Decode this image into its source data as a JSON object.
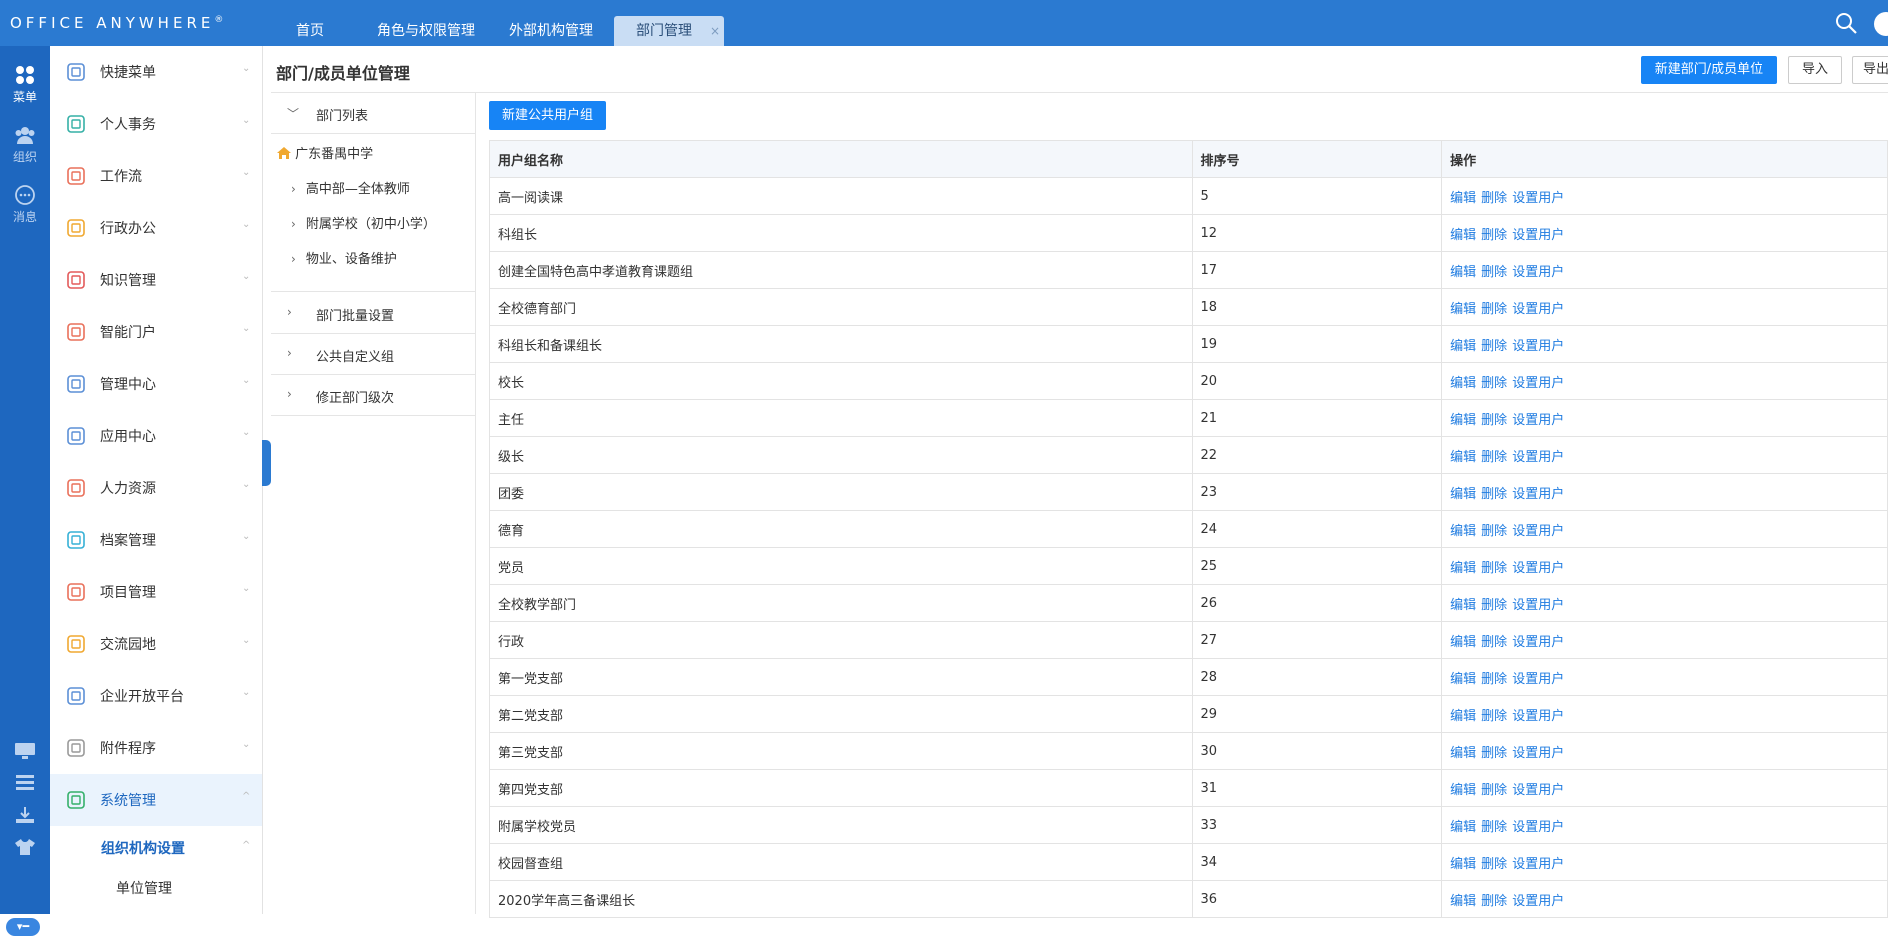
{
  "app": {
    "logo": "OFFICE ANYWHERE",
    "logo_mark": "®",
    "tabs": [
      {
        "label": "首页"
      },
      {
        "label": "角色与权限管理"
      },
      {
        "label": "外部机构管理"
      },
      {
        "label": "部门管理",
        "active": true,
        "close": "×"
      }
    ]
  },
  "rail": {
    "items": [
      {
        "label": "菜单",
        "icon": "apps-icon"
      },
      {
        "label": "组织",
        "icon": "users-icon"
      },
      {
        "label": "消息",
        "icon": "chat-icon"
      }
    ],
    "bottom_icons": [
      "monitor-icon",
      "list-icon",
      "download-icon",
      "shirt-icon"
    ],
    "toggle_label": "▾━"
  },
  "menu": {
    "items": [
      {
        "label": "快捷菜单",
        "icon": "grid-icon",
        "color": "#5b8fd6"
      },
      {
        "label": "个人事务",
        "icon": "person-icon",
        "color": "#35b0a6"
      },
      {
        "label": "工作流",
        "icon": "flow-icon",
        "color": "#e9705a"
      },
      {
        "label": "行政办公",
        "icon": "briefcase-icon",
        "color": "#f0a830"
      },
      {
        "label": "知识管理",
        "icon": "book-icon",
        "color": "#e35a5a"
      },
      {
        "label": "智能门户",
        "icon": "portal-icon",
        "color": "#e9705a"
      },
      {
        "label": "管理中心",
        "icon": "monitor-chart-icon",
        "color": "#5b8fd6"
      },
      {
        "label": "应用中心",
        "icon": "bag-icon",
        "color": "#5b8fd6"
      },
      {
        "label": "人力资源",
        "icon": "people-icon",
        "color": "#e9705a"
      },
      {
        "label": "档案管理",
        "icon": "archive-icon",
        "color": "#35b0d6"
      },
      {
        "label": "项目管理",
        "icon": "stack-icon",
        "color": "#e9705a"
      },
      {
        "label": "交流园地",
        "icon": "cup-icon",
        "color": "#f0a830"
      },
      {
        "label": "企业开放平台",
        "icon": "cube-icon",
        "color": "#5b8fd6"
      },
      {
        "label": "附件程序",
        "icon": "paperclip-icon",
        "color": "#999999"
      },
      {
        "label": "系统管理",
        "icon": "settings-icon",
        "color": "#35b06a",
        "active": true
      }
    ],
    "submenu": {
      "label": "组织机构设置"
    },
    "subsubmenu": {
      "label": "单位管理"
    }
  },
  "page": {
    "title": "部门/成员单位管理",
    "new_dept_label": "新建部门/成员单位",
    "import_label": "导入",
    "export_label": "导出"
  },
  "tree": {
    "list_label": "部门列表",
    "root": "广东番禺中学",
    "children": [
      "高中部—全体教师",
      "附属学校（初中小学）",
      "物业、设备维护"
    ],
    "sections": [
      "部门批量设置",
      "公共自定义组",
      "修正部门级次"
    ]
  },
  "table": {
    "new_group_label": "新建公共用户组",
    "headers": [
      "用户组名称",
      "排序号",
      "操作"
    ],
    "ops": [
      "编辑",
      "删除",
      "设置用户"
    ],
    "rows": [
      {
        "name": "高一阅读课",
        "order": "5"
      },
      {
        "name": "科组长",
        "order": "12"
      },
      {
        "name": "创建全国特色高中孝道教育课题组",
        "order": "17"
      },
      {
        "name": "全校德育部门",
        "order": "18"
      },
      {
        "name": "科组长和备课组长",
        "order": "19"
      },
      {
        "name": "校长",
        "order": "20"
      },
      {
        "name": "主任",
        "order": "21"
      },
      {
        "name": "级长",
        "order": "22"
      },
      {
        "name": "团委",
        "order": "23"
      },
      {
        "name": "德育",
        "order": "24"
      },
      {
        "name": "党员",
        "order": "25"
      },
      {
        "name": "全校教学部门",
        "order": "26"
      },
      {
        "name": "行政",
        "order": "27"
      },
      {
        "name": "第一党支部",
        "order": "28"
      },
      {
        "name": "第二党支部",
        "order": "29"
      },
      {
        "name": "第三党支部",
        "order": "30"
      },
      {
        "name": "第四党支部",
        "order": "31"
      },
      {
        "name": "附属学校党员",
        "order": "33"
      },
      {
        "name": "校园督查组",
        "order": "34"
      },
      {
        "name": "2020学年高三备课组长",
        "order": "36"
      }
    ]
  }
}
